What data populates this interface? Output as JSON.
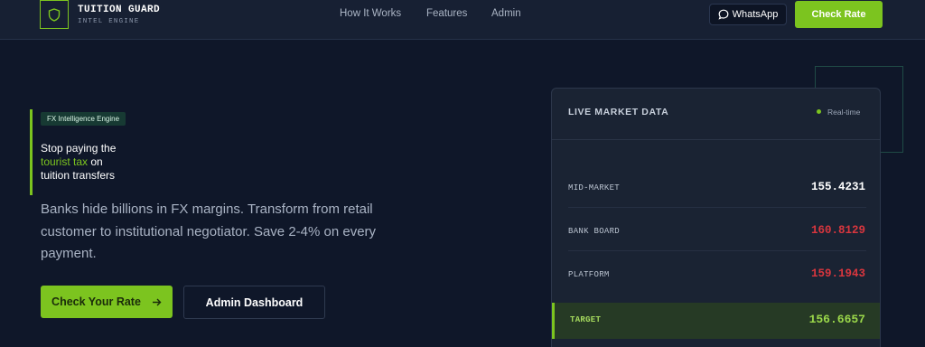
{
  "brand": {
    "title": "TUITION GUARD",
    "subtitle": "INTEL ENGINE",
    "icon": "shield-icon",
    "accent": "#7cc41f"
  },
  "nav": {
    "how_it_works": "How It Works",
    "features": "Features",
    "admin": "Admin"
  },
  "header_actions": {
    "whatsapp_label": "WhatsApp",
    "whatsapp_icon": "chat-bubble-icon",
    "check_rate_label": "Check Rate"
  },
  "hero": {
    "badge": "FX Intelligence Engine",
    "headline_part1": "Stop paying the",
    "headline_highlight": "tourist tax",
    "headline_part2": " on",
    "headline_part3": "tuition transfers",
    "description": "Banks hide billions in FX margins. Transform from retail customer to institutional negotiator. Save 2-4% on every payment.",
    "primary_button": "Check Your Rate",
    "primary_button_icon": "arrow-right-icon",
    "secondary_button": "Admin Dashboard"
  },
  "market": {
    "title": "LIVE MARKET DATA",
    "status": "Real-time",
    "rows": [
      {
        "label": "MID-MARKET",
        "value": "155.4231",
        "color": "#ffffff"
      },
      {
        "label": "BANK BOARD",
        "value": "160.8129",
        "color": "#d9363e"
      },
      {
        "label": "PLATFORM",
        "value": "159.1943",
        "color": "#d9363e"
      },
      {
        "label": "TARGET",
        "value": "156.6657",
        "color": "#9bd84a"
      }
    ]
  }
}
